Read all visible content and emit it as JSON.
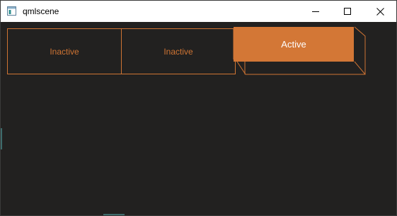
{
  "window": {
    "title": "qmlscene"
  },
  "tabs": [
    {
      "label": "Inactive",
      "state": "inactive"
    },
    {
      "label": "Inactive",
      "state": "inactive"
    },
    {
      "label": "Active",
      "state": "active"
    }
  ],
  "colors": {
    "accent": "#d37736",
    "accent_border": "#cf7433",
    "background": "#222120",
    "titlebar": "#ffffff"
  },
  "icons": {
    "app": "app-window-icon",
    "minimize": "minimize-icon",
    "maximize": "maximize-icon",
    "close": "close-icon"
  }
}
